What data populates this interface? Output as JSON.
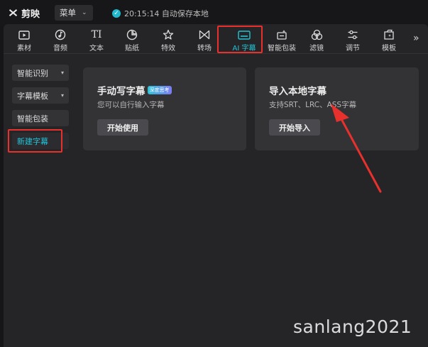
{
  "app": {
    "logo_text": "剪映"
  },
  "topbar": {
    "menu_label": "菜单",
    "save_status": "20:15:14 自动保存本地"
  },
  "tabs": [
    {
      "label": "素材",
      "icon": "media-icon"
    },
    {
      "label": "音频",
      "icon": "audio-icon"
    },
    {
      "label": "文本",
      "icon": "text-icon",
      "glyph": "TI"
    },
    {
      "label": "贴纸",
      "icon": "sticker-icon"
    },
    {
      "label": "特效",
      "icon": "effects-icon"
    },
    {
      "label": "转场",
      "icon": "transition-icon"
    },
    {
      "label": "AI 字幕",
      "icon": "ai-subtitle-icon"
    },
    {
      "label": "智能包装",
      "icon": "smart-pack-icon"
    },
    {
      "label": "滤镜",
      "icon": "filter-icon"
    },
    {
      "label": "调节",
      "icon": "adjust-icon"
    },
    {
      "label": "模板",
      "icon": "template-icon"
    }
  ],
  "active_tab": "AI 字幕",
  "sidebar": {
    "items": [
      {
        "label": "智能识别",
        "has_dropdown": true
      },
      {
        "label": "字幕模板",
        "has_dropdown": true
      },
      {
        "label": "智能包装",
        "has_dropdown": false
      },
      {
        "label": "新建字幕",
        "has_dropdown": false,
        "active": true
      }
    ]
  },
  "cards": {
    "manual": {
      "title": "手动写字幕",
      "tag": "深度思考",
      "description": "您可以自行输入字幕",
      "button": "开始使用"
    },
    "import": {
      "title": "导入本地字幕",
      "description": "支持SRT、LRC、ASS字幕",
      "button": "开始导入"
    }
  },
  "watermark": "sanlang2021",
  "colors": {
    "accent": "#22c3d6",
    "highlight": "#e8312c",
    "panel": "#252528",
    "card": "#333336"
  }
}
